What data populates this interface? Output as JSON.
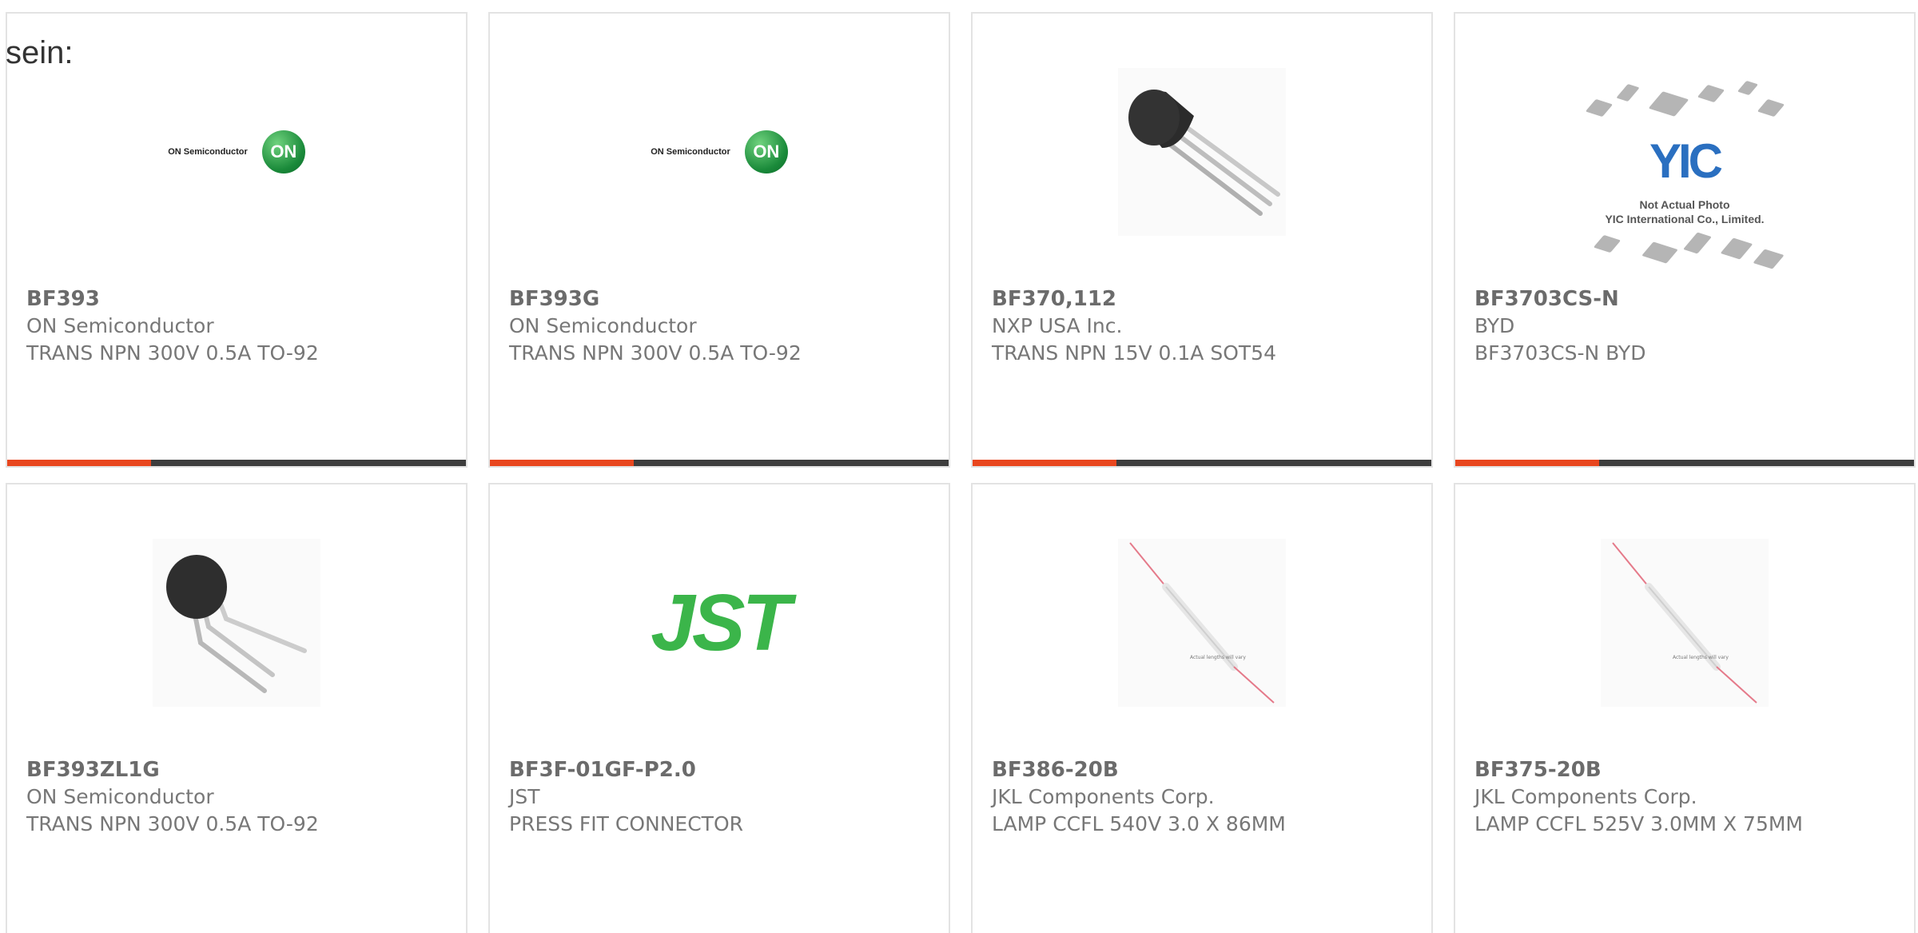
{
  "heading": "sein:",
  "products": [
    {
      "part": "BF393",
      "manufacturer": "ON Semiconductor",
      "description": "TRANS NPN 300V 0.5A TO-92",
      "image": "on-semiconductor-logo"
    },
    {
      "part": "BF393G",
      "manufacturer": "ON Semiconductor",
      "description": "TRANS NPN 300V 0.5A TO-92",
      "image": "on-semiconductor-logo"
    },
    {
      "part": "BF370,112",
      "manufacturer": "NXP USA Inc.",
      "description": "TRANS NPN 15V 0.1A SOT54",
      "image": "to92-transistor"
    },
    {
      "part": "BF3703CS-N",
      "manufacturer": "BYD",
      "description": "BF3703CS-N BYD",
      "image": "yic-not-actual-photo"
    },
    {
      "part": "BF393ZL1G",
      "manufacturer": "ON Semiconductor",
      "description": "TRANS NPN 300V 0.5A TO-92",
      "image": "to92-transistor"
    },
    {
      "part": "BF3F-01GF-P2.0",
      "manufacturer": "JST",
      "description": "PRESS FIT CONNECTOR",
      "image": "jst-logo"
    },
    {
      "part": "BF386-20B",
      "manufacturer": "JKL Components Corp.",
      "description": "LAMP CCFL 540V 3.0 X 86MM",
      "image": "ccfl-lamp"
    },
    {
      "part": "BF375-20B",
      "manufacturer": "JKL Components Corp.",
      "description": "LAMP CCFL 525V 3.0MM X 75MM",
      "image": "ccfl-lamp"
    }
  ],
  "logos": {
    "on_word": "ON Semiconductor",
    "on_ball": "ON",
    "jst": "JST",
    "yic_mark": "YIC",
    "yic_caption_1": "Not Actual Photo",
    "yic_caption_2": "YIC International Co., Limited.",
    "lamp_caption": "Actual lengths will vary"
  },
  "colors": {
    "accent_bar": "#e8461e",
    "bar": "#3d3d3d",
    "on_green": "#1a8a3a",
    "jst_green": "#3bb54a",
    "yic_blue": "#2a6fc0"
  }
}
